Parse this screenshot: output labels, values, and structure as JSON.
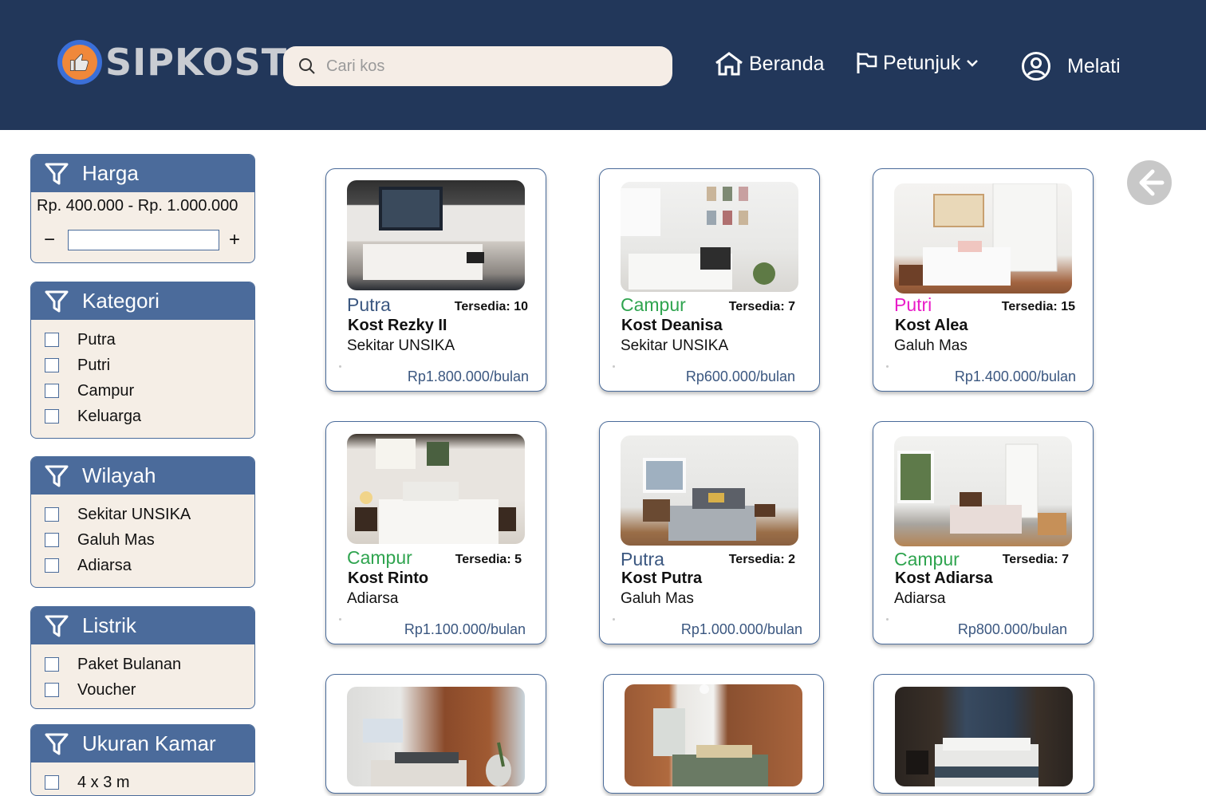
{
  "header": {
    "logo_text": "SIPKOST",
    "search_placeholder": "Cari kos",
    "nav": {
      "home": "Beranda",
      "guide": "Petunjuk",
      "user": "Melati"
    }
  },
  "colors": {
    "header_bg": "#22375a",
    "panel_head": "#4b6b9b",
    "panel_bg": "#f5eee6",
    "putra": "#3b5780",
    "campur": "#2fa44f",
    "putri": "#e91cc8"
  },
  "filters": {
    "harga": {
      "title": "Harga",
      "range": "Rp. 400.000 - Rp. 1.000.000",
      "minus": "−",
      "plus": "+"
    },
    "kategori": {
      "title": "Kategori",
      "options": [
        "Putra",
        "Putri",
        "Campur",
        "Keluarga"
      ]
    },
    "wilayah": {
      "title": "Wilayah",
      "options": [
        "Sekitar UNSIKA",
        "Galuh Mas",
        "Adiarsa"
      ]
    },
    "listrik": {
      "title": "Listrik",
      "options": [
        "Paket Bulanan",
        "Voucher"
      ]
    },
    "ukuran": {
      "title": "Ukuran Kamar",
      "options": [
        "4 x 3 m"
      ]
    }
  },
  "listings": [
    {
      "category": "Putra",
      "available": "Tersedia: 10",
      "name": "Kost Rezky II",
      "area": "Sekitar UNSIKA",
      "price": "Rp1.800.000/bulan"
    },
    {
      "category": "Campur",
      "available": "Tersedia: 7",
      "name": "Kost Deanisa",
      "area": "Sekitar UNSIKA",
      "price": "Rp600.000/bulan"
    },
    {
      "category": "Putri",
      "available": "Tersedia: 15",
      "name": "Kost Alea",
      "area": "Galuh Mas",
      "price": "Rp1.400.000/bulan"
    },
    {
      "category": "Campur",
      "available": "Tersedia: 5",
      "name": "Kost Rinto",
      "area": "Adiarsa",
      "price": "Rp1.100.000/bulan"
    },
    {
      "category": "Putra",
      "available": "Tersedia: 2",
      "name": "Kost Putra",
      "area": "Galuh Mas",
      "price": "Rp1.000.000/bulan"
    },
    {
      "category": "Campur",
      "available": "Tersedia: 7",
      "name": "Kost Adiarsa",
      "area": "Adiarsa",
      "price": "Rp800.000/bulan"
    }
  ],
  "back_button_icon": "arrow-left-icon"
}
